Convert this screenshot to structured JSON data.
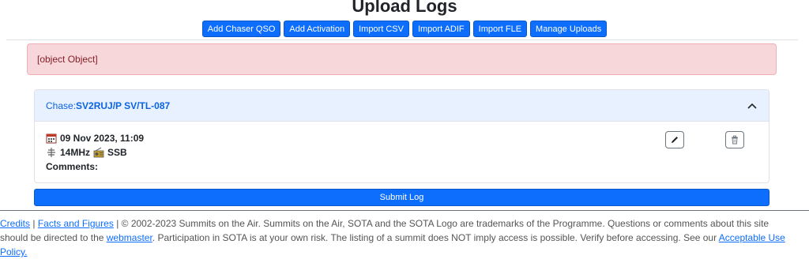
{
  "page": {
    "title": "Upload Logs"
  },
  "toolbar": {
    "buttons": [
      {
        "label": "Add Chaser QSO"
      },
      {
        "label": "Add Activation"
      },
      {
        "label": "Import CSV"
      },
      {
        "label": "Import ADIF"
      },
      {
        "label": "Import FLE"
      },
      {
        "label": "Manage Uploads"
      }
    ]
  },
  "alert": {
    "text": "[object Object]"
  },
  "card": {
    "prefix": "Chase:",
    "callsign": "SV2RUJ/P SV/TL-087",
    "datetime": "09 Nov 2023, 11:09",
    "band": "14MHz",
    "mode": "SSB",
    "comments_label": "Comments:",
    "icons": {
      "header": "chevron-up-icon",
      "date": "calendar-icon",
      "band": "antenna-icon",
      "mode": "radio-icon",
      "edit": "pencil-icon",
      "delete": "trash-icon"
    }
  },
  "submit": {
    "label": "Submit Log"
  },
  "footer": {
    "credits": "Credits",
    "sep": " | ",
    "facts": "Facts and Figures",
    "text1": " | © 2002-2023 Summits on the Air. Summits on the Air, SOTA and the SOTA Logo are trademarks of the Programme. Questions or comments about this site should be directed to the ",
    "webmaster": "webmaster",
    "text2": ". Participation in SOTA is at your own risk. The listing of a summit does NOT imply access is possible. Verify before accessing. See our ",
    "aup": "Acceptable Use Policy."
  },
  "colors": {
    "primary": "#0d6efd",
    "alert_bg": "#f8d7da",
    "alert_text": "#842029",
    "card_head_bg": "#e7f1ff",
    "card_head_text": "#0c63e4"
  }
}
